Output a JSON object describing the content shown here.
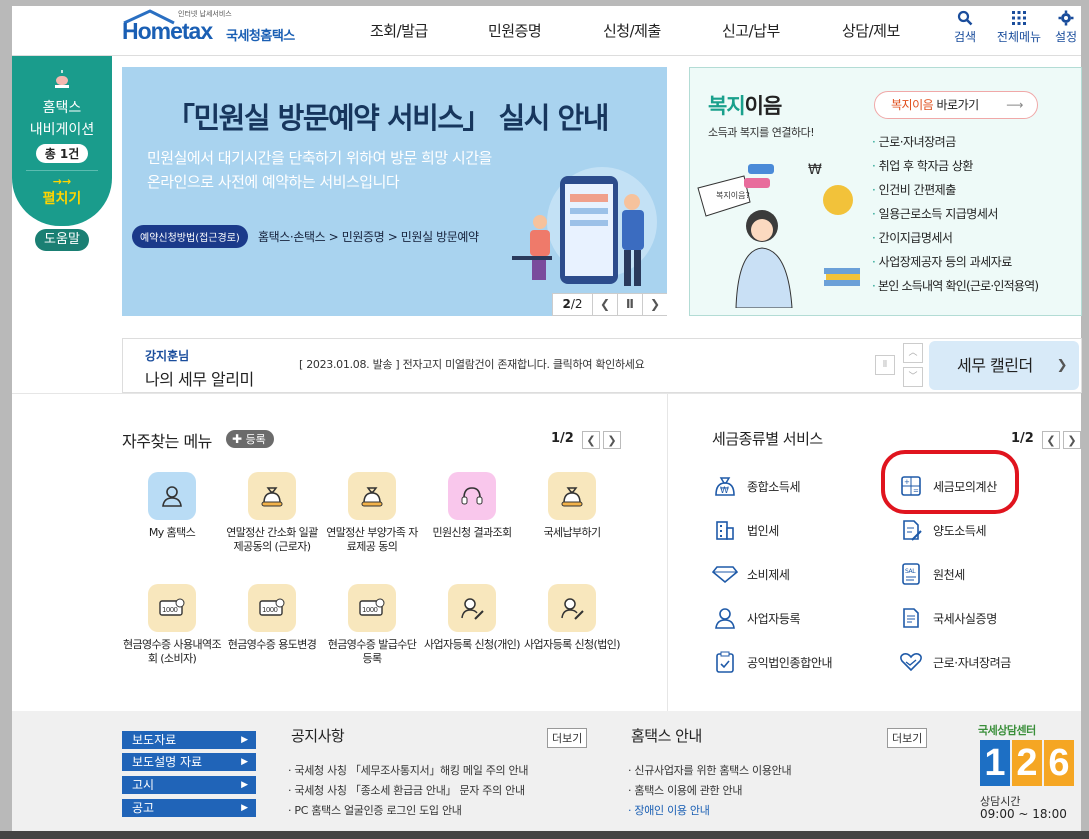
{
  "header": {
    "logo_sub": "인터넷 납세서비스",
    "logo_main": "Hometax",
    "logo_kr": "국세청홈택스",
    "gnb": [
      "조회/발급",
      "민원증명",
      "신청/제출",
      "신고/납부",
      "상담/제보"
    ],
    "util": [
      {
        "label": "검색",
        "icon": "search-icon"
      },
      {
        "label": "전체메뉴",
        "icon": "grid-icon"
      },
      {
        "label": "설정",
        "icon": "gear-icon"
      }
    ]
  },
  "nav_pill": {
    "title1": "홈택스",
    "title2": "내비게이션",
    "count": "총 1건",
    "expand_arrow": "→→",
    "expand": "펼치기",
    "help": "도움말"
  },
  "banner": {
    "title": "「민원실 방문예약 서비스」 실시 안내",
    "desc1": "민원실에서 대기시간을 단축하기 위하여 방문 희망 시간을",
    "desc2": "온라인으로 사전에 예약하는 서비스입니다",
    "path_badge": "예약신청방법(접근경로)",
    "path": "홈택스·손택스 > 민원증명 > 민원실 방문예약",
    "page_current": "2",
    "page_total": "2",
    "page_sep": "/"
  },
  "welfare": {
    "title_a": "복지",
    "title_b": "이음",
    "subtitle": "소득과 복지를 연결하다!",
    "link_a": "복지이음",
    "link_b": " 바로가기",
    "items": [
      "근로·자녀장려금",
      "취업 후 학자금 상환",
      "인건비 간편제출",
      "일용근로소득 지급명세서",
      "간이지급명세서",
      "사업장제공자 등의 과세자료",
      "본인 소득내역 확인(근로·인적용역)"
    ]
  },
  "alarm": {
    "user": "강지훈님",
    "title": "나의 세무 알리미",
    "message": "[ 2023.01.08. 발송 ] 전자고지 미열람건이 존재합니다. 클릭하여 확인하세요",
    "calendar": "세무 캘린더"
  },
  "frequent": {
    "title": "자주찾는 메뉴",
    "register": "등록",
    "page": "1/2",
    "items": [
      {
        "label": "My 홈택스",
        "icon": "person-icon"
      },
      {
        "label": "연말정산 간소화 일괄제공동의 (근로자)",
        "icon": "money-bag-icon"
      },
      {
        "label": "연말정산 부양가족 자료제공 동의",
        "icon": "money-bag-icon"
      },
      {
        "label": "민원신청 결과조회",
        "icon": "headset-icon"
      },
      {
        "label": "국세납부하기",
        "icon": "money-bag-icon"
      },
      {
        "label": "현금영수증 사용내역조회 (소비자)",
        "icon": "receipt-icon"
      },
      {
        "label": "현금영수증 용도변경",
        "icon": "receipt-icon"
      },
      {
        "label": "현금영수증 발급수단 등록",
        "icon": "receipt-icon"
      },
      {
        "label": "사업자등록 신청(개인)",
        "icon": "person-edit-icon"
      },
      {
        "label": "사업자등록 신청(법인)",
        "icon": "person-edit-icon"
      }
    ]
  },
  "tax_service": {
    "title": "세금종류별 서비스",
    "page": "1/2",
    "items": [
      {
        "label": "종합소득세",
        "icon": "money-sack-icon"
      },
      {
        "label": "세금모의계산",
        "icon": "calculator-icon"
      },
      {
        "label": "법인세",
        "icon": "building-icon"
      },
      {
        "label": "양도소득세",
        "icon": "document-edit-icon"
      },
      {
        "label": "소비제세",
        "icon": "diamond-icon"
      },
      {
        "label": "원천세",
        "icon": "receipt-sal-icon"
      },
      {
        "label": "사업자등록",
        "icon": "person-icon"
      },
      {
        "label": "국세사실증명",
        "icon": "certificate-icon"
      },
      {
        "label": "공익법인종합안내",
        "icon": "clipboard-icon"
      },
      {
        "label": "근로·자녀장려금",
        "icon": "heart-hand-icon"
      }
    ]
  },
  "footer": {
    "side": [
      "보도자료",
      "보도설명 자료",
      "고시",
      "공고"
    ],
    "notice_title": "공지사항",
    "notice_more": "더보기",
    "notices": [
      "국세청 사칭 「세무조사통지서」해킹 메일 주의 안내",
      "국세청 사칭 「종소세 환급금 안내」 문자 주의 안내",
      "PC 홈택스 얼굴인증 로그인 도입 안내"
    ],
    "guide_title": "홈택스 안내",
    "guide_more": "더보기",
    "guides": [
      "신규사업자를 위한 홈택스 이용안내",
      "홈택스 이용에 관한 안내",
      "장애인 이용 안내"
    ],
    "center_title": "국세상담센터",
    "center_number": "126",
    "hours_label": "상담시간",
    "hours": "09:00 ~ 18:00"
  },
  "colors": {
    "primary": "#2064b8",
    "teal": "#1a9c8c",
    "highlight": "#e0141e"
  }
}
